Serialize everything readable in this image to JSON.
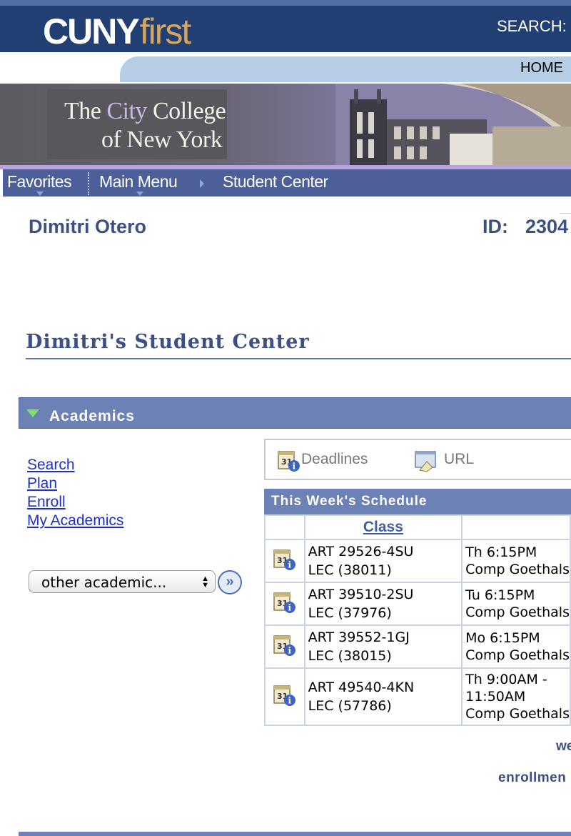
{
  "header": {
    "logo_part1": "CUNY",
    "logo_part2": "first",
    "search_label": "SEARCH:",
    "home_link": "HOME"
  },
  "banner": {
    "line1_a": "The ",
    "line1_b": "City",
    "line1_c": " College",
    "line2": "of New York"
  },
  "nav": {
    "favorites": "Favorites",
    "main_menu": "Main Menu",
    "current": "Student Center"
  },
  "student": {
    "name": "Dimitri Otero",
    "id_label": "ID:",
    "id_value": "2304"
  },
  "page_title": "Dimitri's Student Center",
  "academics": {
    "section_title": "Academics",
    "links": [
      "Search",
      "Plan",
      "Enroll",
      "My Academics"
    ],
    "select_value": "other academic...",
    "go_button": "»"
  },
  "toolbar": {
    "deadlines": "Deadlines",
    "url": "URL"
  },
  "schedule": {
    "title": "This Week's Schedule",
    "column_class": "Class",
    "rows": [
      {
        "class_line1": "ART 29526-4SU",
        "class_line2": "LEC (38011)",
        "time_line1": "Th 6:15PM",
        "time_line2": "Comp Goethals",
        "time_line3": ""
      },
      {
        "class_line1": "ART 39510-2SU",
        "class_line2": "LEC (37976)",
        "time_line1": "Tu 6:15PM",
        "time_line2": "Comp Goethals",
        "time_line3": ""
      },
      {
        "class_line1": "ART 39552-1GJ",
        "class_line2": "LEC (38015)",
        "time_line1": "Mo 6:15PM",
        "time_line2": "Comp Goethals",
        "time_line3": ""
      },
      {
        "class_line1": "ART 49540-4KN",
        "class_line2": "LEC (57786)",
        "time_line1": "Th 9:00AM -",
        "time_line2": "11:50AM",
        "time_line3": "Comp Goethals"
      }
    ]
  },
  "footer_links": {
    "weekly": "we",
    "enrollment": "enrollmen"
  },
  "colors": {
    "top_bar": "#213f72",
    "nav_bar": "#4c5f99",
    "section_header": "#6c81b6",
    "link": "#1f2fcc",
    "heading": "#3c5086"
  }
}
